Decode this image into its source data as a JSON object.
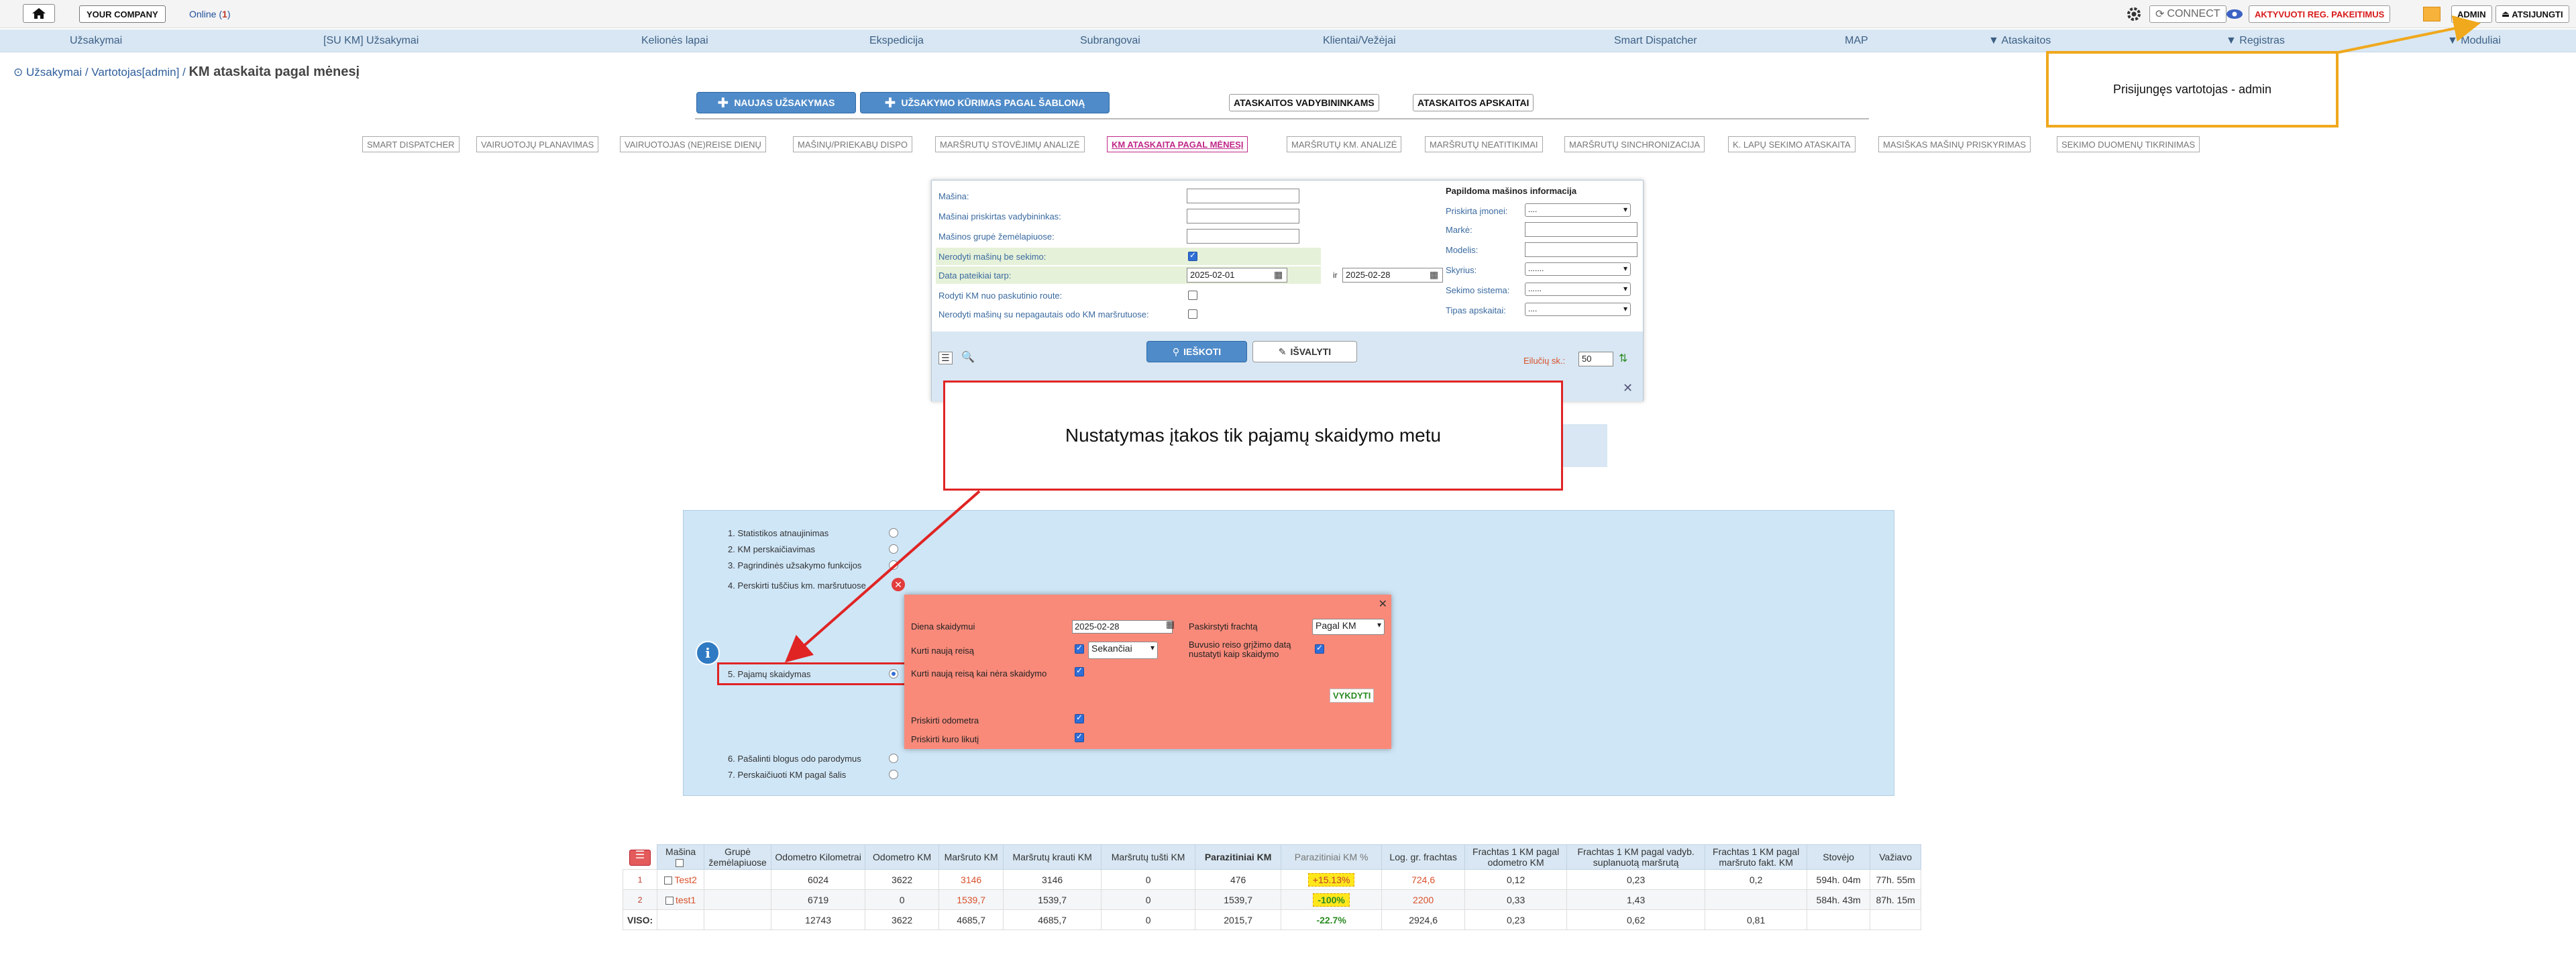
{
  "topbar": {
    "company": "YOUR COMPANY",
    "online_label": "Online (",
    "online_count": "1",
    "online_close": ")",
    "connect": "CONNECT",
    "reg_changes": "AKTYVUOTI REG. PAKEITIMUS",
    "admin": "ADMIN",
    "logout": "ATSIJUNGTI"
  },
  "nav": [
    "Užsakymai",
    "[SU KM] Užsakymai",
    "Kelionės lapai",
    "Ekspedicija",
    "Subrangovai",
    "Klientai/Vežėjai",
    "Smart Dispatcher",
    "MAP",
    "▼ Ataskaitos",
    "▼ Registras",
    "▼ Moduliai"
  ],
  "breadcrumb": {
    "a": "Užsakymai",
    "b": "Vartotojas[admin]",
    "current": "KM ataskaita pagal mėnesį"
  },
  "buttons": {
    "new_order": "NAUJAS UŽSAKYMAS",
    "template_order": "UŽSAKYMO KŪRIMAS PAGAL ŠABLONĄ",
    "manager_reports": "ATASKAITOS VADYBININKAMS",
    "reports_accounting": "ATASKAITOS APSKAITAI"
  },
  "tabs": [
    "SMART DISPATCHER",
    "VAIRUOTOJŲ PLANAVIMAS",
    "VAIRUOTOJAS (NE)REISE DIENŲ",
    "MAŠINŲ/PRIEKABŲ DISPO",
    "MARŠRUTŲ STOVĖJIMŲ ANALIZĖ",
    "KM ATASKAITA PAGAL MĖNESĮ",
    "MARŠRUTŲ KM. ANALIZĖ",
    "MARŠRUTŲ NEATITIKIMAI",
    "MARŠRUTŲ SINCHRONIZACIJA",
    "K. LAPŲ SEKIMO ATASKAITA",
    "MASIŠKAS MAŠINŲ PRISKYRIMAS",
    "SEKIMO DUOMENŲ TIKRINIMAS"
  ],
  "filter": {
    "rows": [
      "Mašina:",
      "Mašinai priskirtas vadybininkas:",
      "Mašinos grupė žemėlapiuose:",
      "Nerodyti mašinų be sekimo:",
      "Data pateikiai tarp:",
      "Rodyti KM nuo paskutinio route:",
      "Nerodyti mašinų su nepagautais odo KM maršrutuose:"
    ],
    "date_from": "2025-02-01",
    "date_sep": "ir",
    "date_to": "2025-02-28",
    "side_title": "Papildoma mašinos informacija",
    "side_rows": [
      "Priskirta įmonei:",
      "Markė:",
      "Modelis:",
      "Skyrius:",
      "Sekimo sistema:",
      "Tipas apskaitai:"
    ],
    "side_sel": [
      "....",
      "",
      "",
      ".......",
      "......",
      "...."
    ],
    "search": "IEŠKOTI",
    "clear": "IŠVALYTI",
    "rows_label": "Eilučių sk.:",
    "rows_value": "50"
  },
  "callouts": {
    "main": "Nustatymas įtakos tik pajamų skaidymo metu",
    "admin": "Prisijungęs vartotojas - admin"
  },
  "options": [
    "1. Statistikos atnaujinimas",
    "2. KM perskaičiavimas",
    "3. Pagrindinės užsakymo funkcijos",
    "4. Perskirti tuščius km. maršrutuose",
    "5. Pajamų skaidymas",
    "6. Pašalinti blogus odo parodymus",
    "7. Perskaičiuoti KM pagal šalis"
  ],
  "split": {
    "date_label": "Diena skaidymui",
    "date_value": "2025-02-28",
    "freight_label": "Paskirstyti frachtą",
    "freight_value": "Pagal KM",
    "new_trip_label": "Kurti naują reisą",
    "new_trip_value": "Sekančiai",
    "return_label": "Buvusio reiso grįžimo datą nustatyti kaip skaidymo",
    "no_split_label": "Kurti naują reisą kai nėra skaidymo",
    "odometer_label": "Priskirti odometra",
    "fuel_label": "Priskirti kuro likutį",
    "run": "VYKDYTI"
  },
  "table": {
    "headers": [
      "Mašina",
      "Grupė žemėlapiuose",
      "Odometro Kilometrai",
      "Odometro KM",
      "Maršruto KM",
      "Maršrutų krauti KM",
      "Maršrutų tušti KM",
      "Parazitiniai KM",
      "Parazitiniai KM %",
      "Log. gr. frachtas",
      "Frachtas 1 KM pagal odometro KM",
      "Frachtas 1 KM pagal vadyb. suplanuotą maršrutą",
      "Frachtas 1 KM pagal maršruto fakt. KM",
      "Stovėjo",
      "Važiavo"
    ],
    "rows": [
      {
        "num": "1",
        "car": "Test2",
        "group": "",
        "odo_km_total": "6024",
        "odo_km": "3622",
        "route_km": "3146",
        "loaded": "3146",
        "empty": "0",
        "parasitic": "476",
        "parasitic_pct": "+15.13%",
        "freight": "724,6",
        "f1": "0,12",
        "f2": "0,23",
        "f3": "0,2",
        "stood": "594h. 04m",
        "drove": "77h. 55m"
      },
      {
        "num": "2",
        "car": "test1",
        "group": "",
        "odo_km_total": "6719",
        "odo_km": "0",
        "route_km": "1539,7",
        "loaded": "1539,7",
        "empty": "0",
        "parasitic": "1539,7",
        "parasitic_pct": "-100%",
        "freight": "2200",
        "f1": "0,33",
        "f2": "1,43",
        "f3": "",
        "stood": "584h. 43m",
        "drove": "87h. 15m"
      }
    ],
    "total": {
      "label": "VISO:",
      "odo_km_total": "12743",
      "odo_km": "3622",
      "route_km": "4685,7",
      "loaded": "4685,7",
      "empty": "0",
      "parasitic": "2015,7",
      "parasitic_pct": "-22.7%",
      "freight": "2924,6",
      "f1": "0,23",
      "f2": "0,62",
      "f3": "0,81",
      "stood": "",
      "drove": ""
    }
  }
}
